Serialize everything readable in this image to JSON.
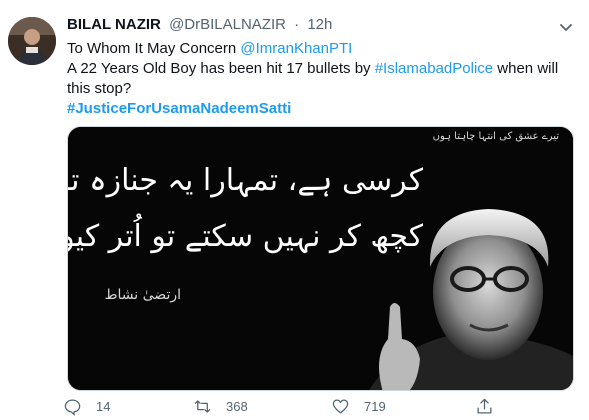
{
  "tweet": {
    "display_name": "BILAL NAZIR",
    "handle": "@DrBILALNAZIR",
    "separator": "·",
    "time": "12h",
    "line1_text": "To Whom It May Concern ",
    "line1_mention": "@ImranKhanPTI",
    "line2_text_a": "A 22 Years Old Boy has been hit 17 bullets by ",
    "line2_hashtag": "#IslamabadPolice",
    "line2_text_b": " when will this stop?",
    "line3_hashtag": "#JusticeForUsamaNadeemSatti"
  },
  "media": {
    "urdu_line1": "کرسی ہے، تمہارا یہ جنازہ تو نہیں ہے",
    "urdu_line2": "کچھ کر نہیں سکتے تو اُتر کیوں نہیں جاتے",
    "poet": "ارتضیٰ نشاط",
    "corner_caption": "تیرے عشق کی انتہا چاہتا ہوں"
  },
  "actions": {
    "reply_count": "14",
    "retweet_count": "368",
    "like_count": "719"
  },
  "icons": {
    "avatar": "avatar",
    "more": "chevron-down-icon",
    "reply": "reply-icon",
    "retweet": "retweet-icon",
    "like": "heart-icon",
    "share": "share-icon"
  },
  "colors": {
    "link": "#1d9bf0",
    "muted": "#536471",
    "text": "#0f1419"
  }
}
